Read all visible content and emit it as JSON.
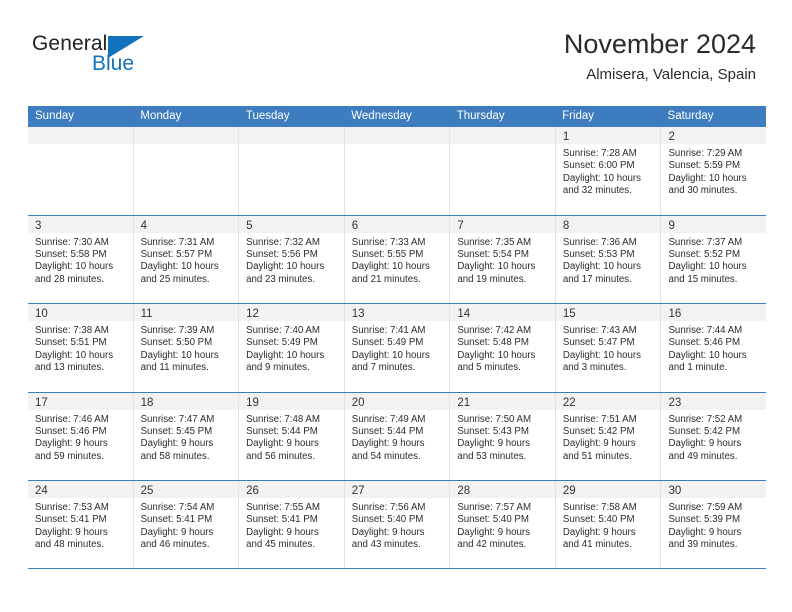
{
  "brand": {
    "name_top": "General",
    "name_bottom": "Blue",
    "accent_color": "#1272bb"
  },
  "header": {
    "title": "November 2024",
    "subtitle": "Almisera, Valencia, Spain"
  },
  "calendar": {
    "header_color": "#3d7cbf",
    "weekday_headers": [
      "Sunday",
      "Monday",
      "Tuesday",
      "Wednesday",
      "Thursday",
      "Friday",
      "Saturday"
    ],
    "weeks": [
      [
        {
          "day": "",
          "lines": []
        },
        {
          "day": "",
          "lines": []
        },
        {
          "day": "",
          "lines": []
        },
        {
          "day": "",
          "lines": []
        },
        {
          "day": "",
          "lines": []
        },
        {
          "day": "1",
          "lines": [
            "Sunrise: 7:28 AM",
            "Sunset: 6:00 PM",
            "Daylight: 10 hours",
            "and 32 minutes."
          ]
        },
        {
          "day": "2",
          "lines": [
            "Sunrise: 7:29 AM",
            "Sunset: 5:59 PM",
            "Daylight: 10 hours",
            "and 30 minutes."
          ]
        }
      ],
      [
        {
          "day": "3",
          "lines": [
            "Sunrise: 7:30 AM",
            "Sunset: 5:58 PM",
            "Daylight: 10 hours",
            "and 28 minutes."
          ]
        },
        {
          "day": "4",
          "lines": [
            "Sunrise: 7:31 AM",
            "Sunset: 5:57 PM",
            "Daylight: 10 hours",
            "and 25 minutes."
          ]
        },
        {
          "day": "5",
          "lines": [
            "Sunrise: 7:32 AM",
            "Sunset: 5:56 PM",
            "Daylight: 10 hours",
            "and 23 minutes."
          ]
        },
        {
          "day": "6",
          "lines": [
            "Sunrise: 7:33 AM",
            "Sunset: 5:55 PM",
            "Daylight: 10 hours",
            "and 21 minutes."
          ]
        },
        {
          "day": "7",
          "lines": [
            "Sunrise: 7:35 AM",
            "Sunset: 5:54 PM",
            "Daylight: 10 hours",
            "and 19 minutes."
          ]
        },
        {
          "day": "8",
          "lines": [
            "Sunrise: 7:36 AM",
            "Sunset: 5:53 PM",
            "Daylight: 10 hours",
            "and 17 minutes."
          ]
        },
        {
          "day": "9",
          "lines": [
            "Sunrise: 7:37 AM",
            "Sunset: 5:52 PM",
            "Daylight: 10 hours",
            "and 15 minutes."
          ]
        }
      ],
      [
        {
          "day": "10",
          "lines": [
            "Sunrise: 7:38 AM",
            "Sunset: 5:51 PM",
            "Daylight: 10 hours",
            "and 13 minutes."
          ]
        },
        {
          "day": "11",
          "lines": [
            "Sunrise: 7:39 AM",
            "Sunset: 5:50 PM",
            "Daylight: 10 hours",
            "and 11 minutes."
          ]
        },
        {
          "day": "12",
          "lines": [
            "Sunrise: 7:40 AM",
            "Sunset: 5:49 PM",
            "Daylight: 10 hours",
            "and 9 minutes."
          ]
        },
        {
          "day": "13",
          "lines": [
            "Sunrise: 7:41 AM",
            "Sunset: 5:49 PM",
            "Daylight: 10 hours",
            "and 7 minutes."
          ]
        },
        {
          "day": "14",
          "lines": [
            "Sunrise: 7:42 AM",
            "Sunset: 5:48 PM",
            "Daylight: 10 hours",
            "and 5 minutes."
          ]
        },
        {
          "day": "15",
          "lines": [
            "Sunrise: 7:43 AM",
            "Sunset: 5:47 PM",
            "Daylight: 10 hours",
            "and 3 minutes."
          ]
        },
        {
          "day": "16",
          "lines": [
            "Sunrise: 7:44 AM",
            "Sunset: 5:46 PM",
            "Daylight: 10 hours",
            "and 1 minute."
          ]
        }
      ],
      [
        {
          "day": "17",
          "lines": [
            "Sunrise: 7:46 AM",
            "Sunset: 5:46 PM",
            "Daylight: 9 hours",
            "and 59 minutes."
          ]
        },
        {
          "day": "18",
          "lines": [
            "Sunrise: 7:47 AM",
            "Sunset: 5:45 PM",
            "Daylight: 9 hours",
            "and 58 minutes."
          ]
        },
        {
          "day": "19",
          "lines": [
            "Sunrise: 7:48 AM",
            "Sunset: 5:44 PM",
            "Daylight: 9 hours",
            "and 56 minutes."
          ]
        },
        {
          "day": "20",
          "lines": [
            "Sunrise: 7:49 AM",
            "Sunset: 5:44 PM",
            "Daylight: 9 hours",
            "and 54 minutes."
          ]
        },
        {
          "day": "21",
          "lines": [
            "Sunrise: 7:50 AM",
            "Sunset: 5:43 PM",
            "Daylight: 9 hours",
            "and 53 minutes."
          ]
        },
        {
          "day": "22",
          "lines": [
            "Sunrise: 7:51 AM",
            "Sunset: 5:42 PM",
            "Daylight: 9 hours",
            "and 51 minutes."
          ]
        },
        {
          "day": "23",
          "lines": [
            "Sunrise: 7:52 AM",
            "Sunset: 5:42 PM",
            "Daylight: 9 hours",
            "and 49 minutes."
          ]
        }
      ],
      [
        {
          "day": "24",
          "lines": [
            "Sunrise: 7:53 AM",
            "Sunset: 5:41 PM",
            "Daylight: 9 hours",
            "and 48 minutes."
          ]
        },
        {
          "day": "25",
          "lines": [
            "Sunrise: 7:54 AM",
            "Sunset: 5:41 PM",
            "Daylight: 9 hours",
            "and 46 minutes."
          ]
        },
        {
          "day": "26",
          "lines": [
            "Sunrise: 7:55 AM",
            "Sunset: 5:41 PM",
            "Daylight: 9 hours",
            "and 45 minutes."
          ]
        },
        {
          "day": "27",
          "lines": [
            "Sunrise: 7:56 AM",
            "Sunset: 5:40 PM",
            "Daylight: 9 hours",
            "and 43 minutes."
          ]
        },
        {
          "day": "28",
          "lines": [
            "Sunrise: 7:57 AM",
            "Sunset: 5:40 PM",
            "Daylight: 9 hours",
            "and 42 minutes."
          ]
        },
        {
          "day": "29",
          "lines": [
            "Sunrise: 7:58 AM",
            "Sunset: 5:40 PM",
            "Daylight: 9 hours",
            "and 41 minutes."
          ]
        },
        {
          "day": "30",
          "lines": [
            "Sunrise: 7:59 AM",
            "Sunset: 5:39 PM",
            "Daylight: 9 hours",
            "and 39 minutes."
          ]
        }
      ]
    ]
  }
}
